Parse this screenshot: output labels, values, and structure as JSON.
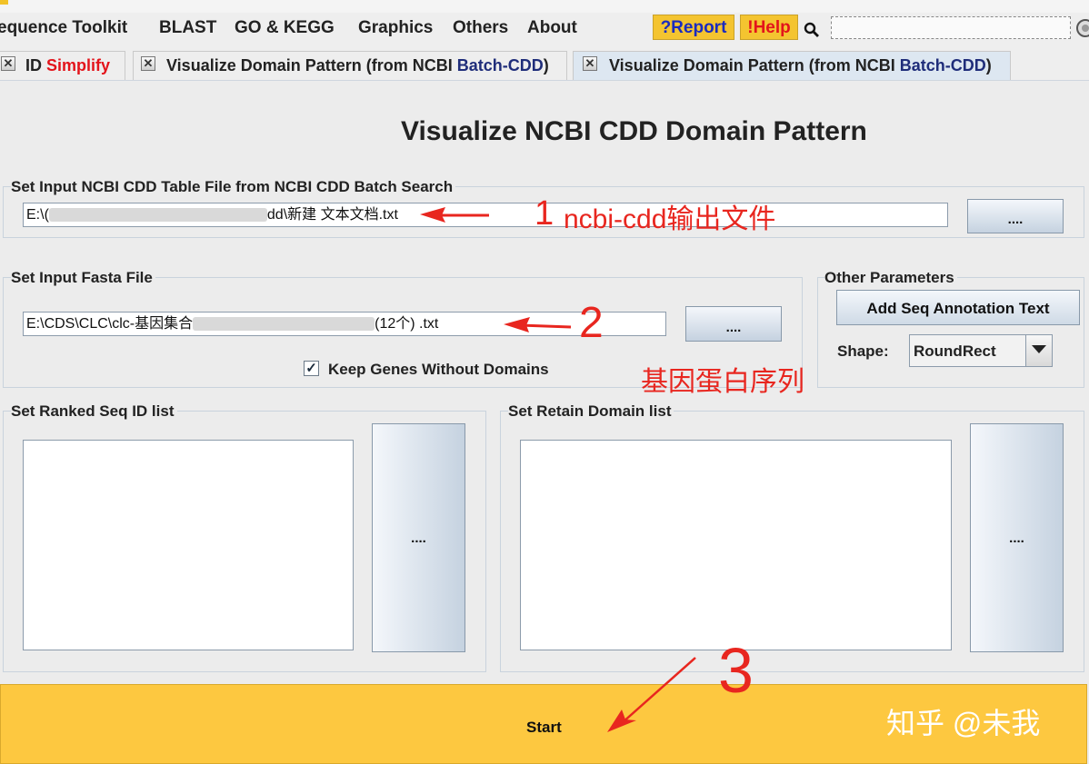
{
  "colors": {
    "accent": "#f4c430",
    "start_bg": "#fdc840",
    "annotation": "#e8261f",
    "tab_active": "#dde7f1"
  },
  "menu": {
    "items": [
      {
        "label": "equence Toolkit"
      },
      {
        "label": "BLAST"
      },
      {
        "label": "GO & KEGG"
      },
      {
        "label": "Graphics"
      },
      {
        "label": "Others"
      },
      {
        "label": "About"
      }
    ],
    "report_label": "?Report",
    "help_label": "!Help",
    "search_icon": "magnifier-icon",
    "search_placeholder": ""
  },
  "tabs": [
    {
      "label_prefix": "ID ",
      "label_accent": "Simplify",
      "close": "✕"
    },
    {
      "label_prefix": "Visualize Domain Pattern (from NCBI ",
      "label_accent": "Batch-CDD",
      "label_suffix": ")",
      "close": "✕"
    },
    {
      "label_prefix": "Visualize Domain Pattern (from NCBI ",
      "label_accent": "Batch-CDD",
      "label_suffix": ")",
      "close": "✕",
      "active": true
    }
  ],
  "main": {
    "title": "Visualize NCBI CDD Domain Pattern",
    "cdd_group": {
      "label": "Set Input NCBI CDD Table File from NCBI CDD Batch Search",
      "path_start": "E:\\(",
      "path_end": "dd\\新建 文本文档.txt",
      "browse_label": "...."
    },
    "fasta_group": {
      "label": "Set Input Fasta File",
      "path_start": "E:\\CDS\\CLC\\clc-基因集合",
      "path_end": "(12个) .txt",
      "browse_label": "....",
      "keep_genes_label": "Keep Genes Without Domains",
      "keep_genes_checked": true
    },
    "other_params": {
      "label": "Other Parameters",
      "add_annotation_label": "Add Seq Annotation Text",
      "shape_label": "Shape:",
      "shape_value": "RoundRect"
    },
    "ranked_group": {
      "label": "Set Ranked Seq ID list",
      "browse_label": "...."
    },
    "retain_group": {
      "label": "Set Retain Domain list",
      "browse_label": "...."
    },
    "start_label": "Start"
  },
  "annotations": {
    "note1_num": "1",
    "note1_text": "ncbi-cdd输出文件",
    "note2_num": "2",
    "note2_text": "基因蛋白序列",
    "note3_num": "3",
    "watermark": "知乎 @未我"
  }
}
